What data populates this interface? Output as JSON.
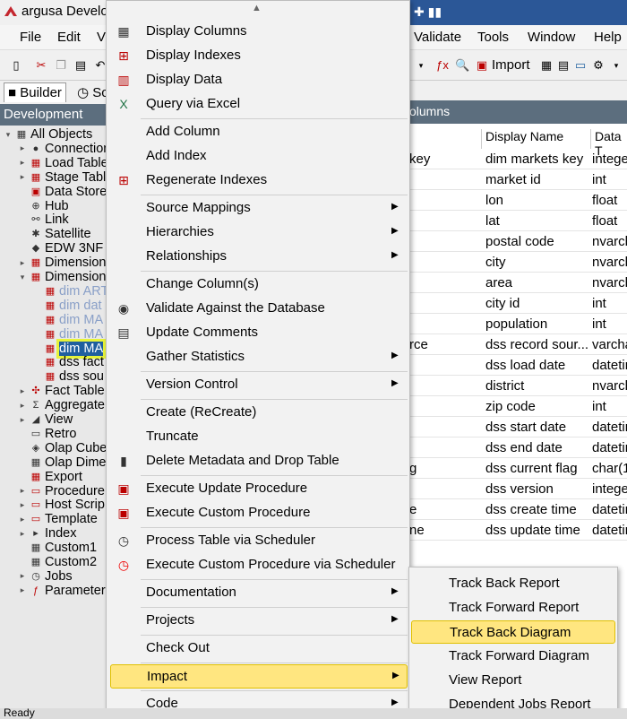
{
  "window": {
    "title": "argusa  Develo"
  },
  "menubar": {
    "items": [
      "File",
      "Edit",
      "V",
      "Validate",
      "Tools",
      "Window",
      "Help"
    ]
  },
  "toolbar": {
    "import_label": "Import"
  },
  "tabs": {
    "builder": "Builder",
    "scheduler": "Sc"
  },
  "left_panel": {
    "header": "Development",
    "tree": [
      {
        "label": "All Objects",
        "icon": "folder-icon",
        "depth": 0,
        "expand": "▾"
      },
      {
        "label": "Connection",
        "icon": "connection-icon",
        "depth": 1,
        "expand": "▸"
      },
      {
        "label": "Load Table",
        "icon": "load-table-icon",
        "depth": 1,
        "expand": "▸"
      },
      {
        "label": "Stage Table",
        "icon": "stage-table-icon",
        "depth": 1,
        "expand": "▸"
      },
      {
        "label": "Data Store",
        "icon": "data-store-icon",
        "depth": 1,
        "expand": ""
      },
      {
        "label": "Hub",
        "icon": "hub-icon",
        "depth": 1,
        "expand": ""
      },
      {
        "label": "Link",
        "icon": "link-icon",
        "depth": 1,
        "expand": ""
      },
      {
        "label": "Satellite",
        "icon": "satellite-icon",
        "depth": 1,
        "expand": ""
      },
      {
        "label": "EDW 3NF",
        "icon": "edw-icon",
        "depth": 1,
        "expand": ""
      },
      {
        "label": "Dimension",
        "icon": "dimension-icon",
        "depth": 1,
        "expand": "▸"
      },
      {
        "label": "Dimension",
        "icon": "dimension-icon",
        "depth": 1,
        "expand": "▾"
      },
      {
        "label": "dim  ART",
        "icon": "table-icon",
        "depth": 2,
        "expand": "",
        "dim": true
      },
      {
        "label": "dim  dat",
        "icon": "table-icon",
        "depth": 2,
        "expand": "",
        "dim": true
      },
      {
        "label": "dim  MA",
        "icon": "table-icon",
        "depth": 2,
        "expand": "",
        "dim": true
      },
      {
        "label": "dim  MA",
        "icon": "table-icon",
        "depth": 2,
        "expand": "",
        "dim": true
      },
      {
        "label": "dim  MA",
        "icon": "table-icon",
        "depth": 2,
        "expand": "",
        "selected": true
      },
      {
        "label": "dss  fact",
        "icon": "table-icon",
        "depth": 2,
        "expand": ""
      },
      {
        "label": "dss  sou",
        "icon": "table-icon",
        "depth": 2,
        "expand": ""
      },
      {
        "label": "Fact Table",
        "icon": "fact-table-icon",
        "depth": 1,
        "expand": "▸"
      },
      {
        "label": "Aggregate",
        "icon": "aggregate-icon",
        "depth": 1,
        "expand": "▸"
      },
      {
        "label": "View",
        "icon": "view-icon",
        "depth": 1,
        "expand": "▸"
      },
      {
        "label": "Retro",
        "icon": "retro-icon",
        "depth": 1,
        "expand": ""
      },
      {
        "label": "Olap Cube",
        "icon": "olap-cube-icon",
        "depth": 1,
        "expand": ""
      },
      {
        "label": "Olap Dime",
        "icon": "olap-dimension-icon",
        "depth": 1,
        "expand": ""
      },
      {
        "label": "Export",
        "icon": "export-icon",
        "depth": 1,
        "expand": ""
      },
      {
        "label": "Procedure",
        "icon": "procedure-icon",
        "depth": 1,
        "expand": "▸"
      },
      {
        "label": "Host Scrip",
        "icon": "host-script-icon",
        "depth": 1,
        "expand": "▸"
      },
      {
        "label": "Template",
        "icon": "template-icon",
        "depth": 1,
        "expand": "▸"
      },
      {
        "label": "Index",
        "icon": "index-icon",
        "depth": 1,
        "expand": "▸"
      },
      {
        "label": "Custom1",
        "icon": "custom-icon",
        "depth": 1,
        "expand": ""
      },
      {
        "label": "Custom2",
        "icon": "custom-icon",
        "depth": 1,
        "expand": ""
      },
      {
        "label": "Jobs",
        "icon": "jobs-icon",
        "depth": 1,
        "expand": "▸"
      },
      {
        "label": "Parameters",
        "icon": "parameters-icon",
        "depth": 1,
        "expand": "▸"
      }
    ]
  },
  "main_panel": {
    "header": "olumns",
    "columns": [
      "Display Name",
      "Data T"
    ],
    "rows": [
      {
        "c0": "key",
        "c1": "dim markets  key",
        "c2": "intege"
      },
      {
        "c0": "",
        "c1": "market id",
        "c2": "int"
      },
      {
        "c0": "",
        "c1": "lon",
        "c2": "float"
      },
      {
        "c0": "",
        "c1": "lat",
        "c2": "float"
      },
      {
        "c0": "",
        "c1": "postal code",
        "c2": "nvarch"
      },
      {
        "c0": "",
        "c1": "city",
        "c2": "nvarch"
      },
      {
        "c0": "",
        "c1": "area",
        "c2": "nvarch"
      },
      {
        "c0": "",
        "c1": "city id",
        "c2": "int"
      },
      {
        "c0": "",
        "c1": "population",
        "c2": "int"
      },
      {
        "c0": "rce",
        "c1": "dss record sour...",
        "c2": "varcha"
      },
      {
        "c0": "",
        "c1": "dss load date",
        "c2": "datetir"
      },
      {
        "c0": "",
        "c1": "district",
        "c2": "nvarch"
      },
      {
        "c0": "",
        "c1": "zip code",
        "c2": "int"
      },
      {
        "c0": "",
        "c1": "dss start date",
        "c2": "datetir"
      },
      {
        "c0": "",
        "c1": "dss end date",
        "c2": "datetir"
      },
      {
        "c0": "g",
        "c1": "dss current flag",
        "c2": "char(1"
      },
      {
        "c0": "",
        "c1": "dss version",
        "c2": "intege"
      },
      {
        "c0": "e",
        "c1": "dss create time",
        "c2": "datetir"
      },
      {
        "c0": "ne",
        "c1": "dss update time",
        "c2": "datetir"
      }
    ]
  },
  "context_menu": {
    "items": [
      {
        "label": "Display Columns",
        "icon": "grid-icon",
        "arrow": false
      },
      {
        "label": "Display Indexes",
        "icon": "index-tree-icon",
        "arrow": false
      },
      {
        "label": "Display Data",
        "icon": "chart-icon",
        "arrow": false
      },
      {
        "label": "Query via Excel",
        "icon": "excel-icon",
        "arrow": false
      },
      {
        "sep": true
      },
      {
        "label": "Add Column",
        "icon": "",
        "arrow": false
      },
      {
        "label": "Add Index",
        "icon": "",
        "arrow": false
      },
      {
        "label": "Regenerate Indexes",
        "icon": "index-tree-icon",
        "arrow": false
      },
      {
        "sep": true
      },
      {
        "label": "Source Mappings",
        "icon": "",
        "arrow": true
      },
      {
        "label": "Hierarchies",
        "icon": "",
        "arrow": true
      },
      {
        "label": "Relationships",
        "icon": "",
        "arrow": true
      },
      {
        "sep": true
      },
      {
        "label": "Change Column(s)",
        "icon": "",
        "arrow": false
      },
      {
        "label": "Validate Against the Database",
        "icon": "validate-db-icon",
        "arrow": false
      },
      {
        "label": "Update Comments",
        "icon": "comment-icon",
        "arrow": false
      },
      {
        "label": "Gather Statistics",
        "icon": "",
        "arrow": true
      },
      {
        "sep": true
      },
      {
        "label": "Version Control",
        "icon": "",
        "arrow": true
      },
      {
        "sep": true
      },
      {
        "label": "Create (ReCreate)",
        "icon": "",
        "arrow": false
      },
      {
        "label": "Truncate",
        "icon": "",
        "arrow": false
      },
      {
        "label": "Delete Metadata and Drop Table",
        "icon": "trash-icon",
        "arrow": false
      },
      {
        "sep": true
      },
      {
        "label": "Execute Update Procedure",
        "icon": "execute-procedure-icon",
        "arrow": false
      },
      {
        "label": "Execute Custom Procedure",
        "icon": "execute-procedure-icon",
        "arrow": false
      },
      {
        "sep": true
      },
      {
        "label": "Process Table via Scheduler",
        "icon": "clock-icon",
        "arrow": false
      },
      {
        "label": "Execute Custom Procedure via Scheduler",
        "icon": "red-clock-icon",
        "arrow": false
      },
      {
        "sep": true
      },
      {
        "label": "Documentation",
        "icon": "",
        "arrow": true
      },
      {
        "sep": true
      },
      {
        "label": "Projects",
        "icon": "",
        "arrow": true
      },
      {
        "sep": true
      },
      {
        "label": "Check Out",
        "icon": "",
        "arrow": false
      },
      {
        "sep": true
      },
      {
        "label": "Impact",
        "icon": "",
        "arrow": true,
        "highlight": true
      },
      {
        "sep": true
      },
      {
        "label": "Code",
        "icon": "",
        "arrow": true
      }
    ]
  },
  "submenu": {
    "items": [
      {
        "label": "Track Back Report"
      },
      {
        "label": "Track Forward Report"
      },
      {
        "label": "Track Back Diagram",
        "highlight": true
      },
      {
        "label": "Track Forward Diagram"
      },
      {
        "label": "View Report"
      },
      {
        "label": "Dependent Jobs Report"
      }
    ]
  },
  "status_bar": {
    "text": "Ready"
  },
  "colors": {
    "highlight": "#ffe680",
    "header": "#5c6e7e",
    "title_bar": "#2b5797"
  }
}
